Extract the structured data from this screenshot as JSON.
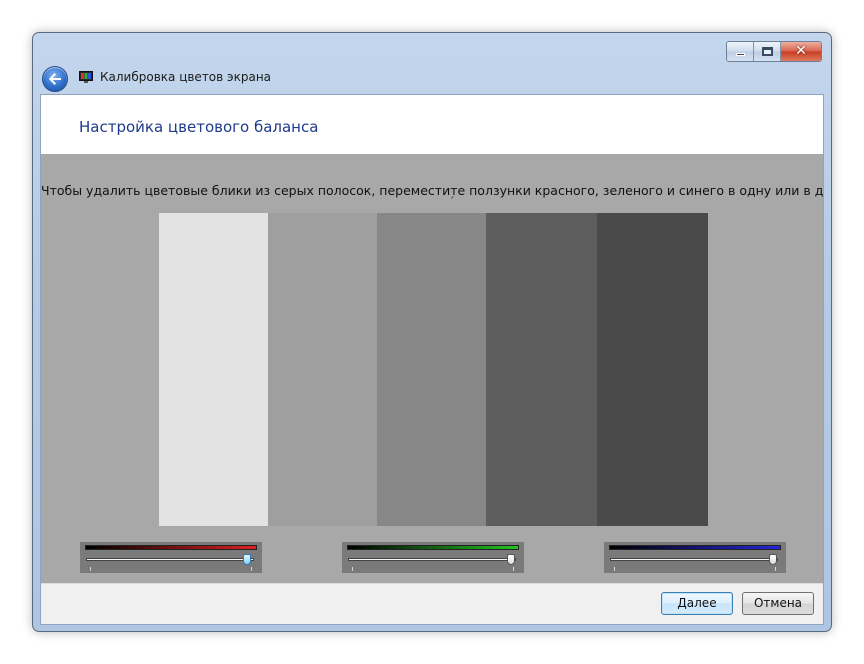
{
  "window": {
    "title": "Калибровка цветов экрана",
    "caption": {
      "close_label": "✕"
    }
  },
  "header": {
    "page_title": "Настройка цветового баланса"
  },
  "main": {
    "instruction": "Чтобы удалить цветовые блики из серых полосок, переместите ползунки красного, зеленого и синего в одну или в другую",
    "instruction_tail": "´",
    "gray_bars": [
      "#e3e3e3",
      "#9f9f9f",
      "#878787",
      "#5d5d5d",
      "#4a4a4a"
    ],
    "sliders": [
      {
        "name": "red",
        "color": "#e02020",
        "value_fraction": 0.97,
        "focused": true
      },
      {
        "name": "green",
        "color": "#22c322",
        "value_fraction": 0.98,
        "focused": false
      },
      {
        "name": "blue",
        "color": "#2626dc",
        "value_fraction": 0.98,
        "focused": false
      }
    ]
  },
  "footer": {
    "next_label": "Далее",
    "cancel_label": "Отмена"
  },
  "colors": {
    "title_blue": "#1e3a8a",
    "panel_gray": "#a8a8a8"
  }
}
